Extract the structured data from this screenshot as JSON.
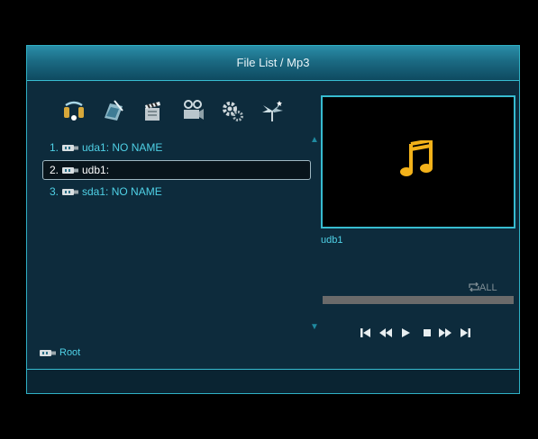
{
  "title": "File List / Mp3",
  "categories": [
    {
      "icon": "music-icon"
    },
    {
      "icon": "photo-icon"
    },
    {
      "icon": "movie-icon"
    },
    {
      "icon": "recording-icon"
    },
    {
      "icon": "settings-icon"
    },
    {
      "icon": "game-icon"
    }
  ],
  "files": [
    {
      "num": "1.",
      "label": "uda1: NO NAME",
      "icon": "usb-drive-icon",
      "selected": false
    },
    {
      "num": "2.",
      "label": "udb1:",
      "icon": "usb-drive-icon",
      "selected": true
    },
    {
      "num": "3.",
      "label": "sda1: NO NAME",
      "icon": "usb-drive-icon",
      "selected": false
    }
  ],
  "preview": {
    "name": "udb1",
    "icon": "music-note-icon"
  },
  "player": {
    "repeat_label": "ALL",
    "progress": 0,
    "controls": [
      "prev-track-icon",
      "rewind-icon",
      "play-icon",
      "stop-icon",
      "fast-forward-icon",
      "next-track-icon"
    ]
  },
  "root_label": "Root",
  "colors": {
    "accent": "#37bcd0",
    "text": "#4fd1e6",
    "note": "#f3b21a"
  }
}
